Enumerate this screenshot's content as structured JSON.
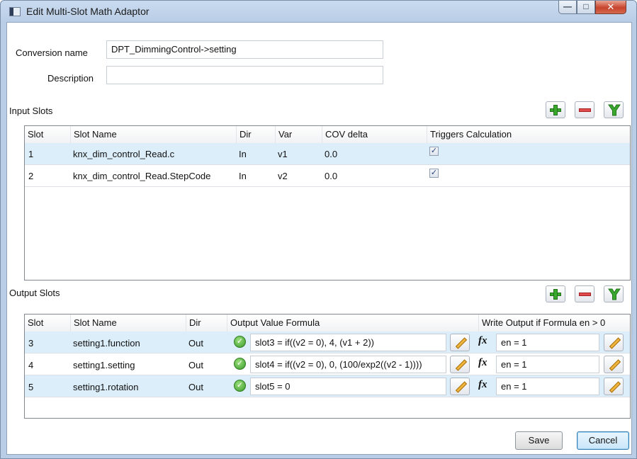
{
  "window": {
    "title": "Edit Multi-Slot Math Adaptor",
    "controls": {
      "minimize": "minimize-icon",
      "maximize": "maximize-icon",
      "close": "close-icon"
    }
  },
  "form": {
    "conversion_name_label": "Conversion name",
    "conversion_name_value": "DPT_DimmingControl->setting",
    "description_label": "Description",
    "description_value": ""
  },
  "input_slots": {
    "title": "Input Slots",
    "columns": [
      "Slot",
      "Slot Name",
      "Dir",
      "Var",
      "COV delta",
      "Triggers Calculation"
    ],
    "rows": [
      {
        "slot": "1",
        "name": "knx_dim_control_Read.c",
        "dir": "In",
        "var": "v1",
        "cov": "0.0",
        "triggers": true,
        "selected": true
      },
      {
        "slot": "2",
        "name": "knx_dim_control_Read.StepCode",
        "dir": "In",
        "var": "v2",
        "cov": "0.0",
        "triggers": true,
        "selected": false
      }
    ]
  },
  "output_slots": {
    "title": "Output Slots",
    "columns": [
      "Slot",
      "Slot Name",
      "Dir",
      "Output Value Formula",
      "Write Output if Formula en > 0"
    ],
    "rows": [
      {
        "slot": "3",
        "name": "setting1.function",
        "dir": "Out",
        "formula": "slot3 = if((v2 = 0), 4, (v1 + 2))",
        "en": "en = 1",
        "selected": true
      },
      {
        "slot": "4",
        "name": "setting1.setting",
        "dir": "Out",
        "formula": "slot4 = if((v2 = 0), 0, (100/exp2((v2 - 1))))",
        "en": "en = 1",
        "selected": false
      },
      {
        "slot": "5",
        "name": "setting1.rotation",
        "dir": "Out",
        "formula": "slot5 = 0",
        "en": "en = 1",
        "selected": true
      }
    ]
  },
  "icons": {
    "add": "plus-icon",
    "remove": "minus-icon",
    "merge": "merge-icon",
    "valid": "check-circle-icon",
    "edit": "pencil-icon",
    "function": "fx-icon"
  },
  "buttons": {
    "save": "Save",
    "cancel": "Cancel"
  },
  "colors": {
    "selected_row": "#dceef9",
    "add_green": "#3aa82e",
    "remove_red": "#e24b4b",
    "title_bar": "#c9dbf0"
  }
}
